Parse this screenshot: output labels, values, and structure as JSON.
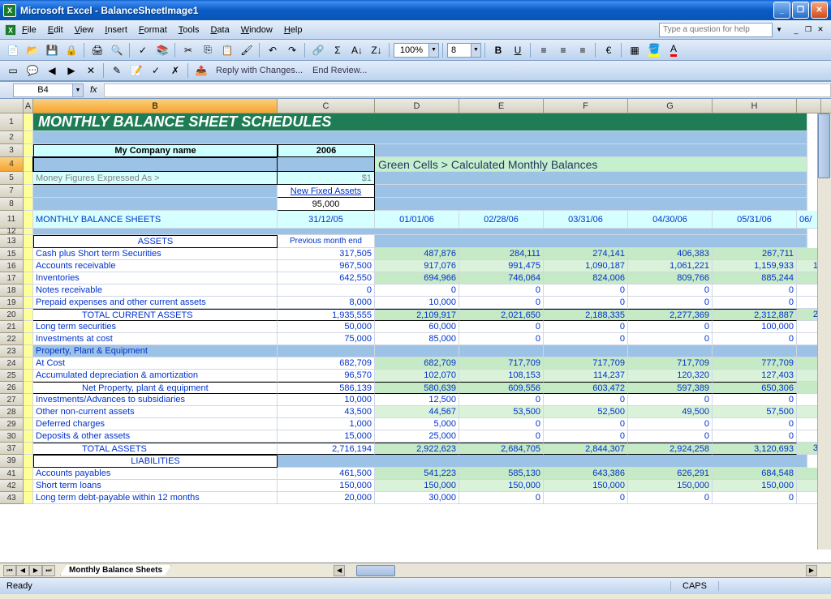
{
  "titlebar": {
    "text": "Microsoft Excel - BalanceSheetImage1"
  },
  "menus": [
    "File",
    "Edit",
    "View",
    "Insert",
    "Format",
    "Tools",
    "Data",
    "Window",
    "Help"
  ],
  "help_placeholder": "Type a question for help",
  "toolbar": {
    "zoom": "100%",
    "font_size": "8",
    "reply": "Reply with Changes...",
    "end": "End Review..."
  },
  "namebox": "B4",
  "sheet": {
    "cols": [
      "A",
      "B",
      "C",
      "D",
      "E",
      "F",
      "G",
      "H"
    ],
    "title": "MONTHLY BALANCE SHEET SCHEDULES",
    "company": "My Company name",
    "year": "2006",
    "legend": "Green Cells > Calculated Monthly Balances",
    "money_label": "Money Figures Expressed As >",
    "money_val": "$1",
    "nfa_label": "New Fixed Assets",
    "nfa_val": "95,000",
    "mbs_label": "MONTHLY BALANCE SHEETS",
    "dates": [
      "31/12/05",
      "01/01/06",
      "02/28/06",
      "03/31/06",
      "04/30/06",
      "05/31/06"
    ],
    "date_next": "06/",
    "prev_month": "Previous month end",
    "assets_h": "ASSETS",
    "liab_h": "LIABILITIES",
    "rows": [
      {
        "n": "15",
        "label": "Cash plus Short term Securities",
        "vals": [
          "317,505",
          "487,876",
          "284,111",
          "274,141",
          "406,383",
          "267,711"
        ],
        "style": "green",
        "tr": ""
      },
      {
        "n": "16",
        "label": "Accounts receivable",
        "vals": [
          "967,500",
          "917,076",
          "991,475",
          "1,090,187",
          "1,061,221",
          "1,159,933"
        ],
        "style": "ltgreen",
        "tr": "1"
      },
      {
        "n": "17",
        "label": "Inventories",
        "vals": [
          "642,550",
          "694,966",
          "746,064",
          "824,006",
          "809,766",
          "885,244"
        ],
        "style": "green",
        "tr": ""
      },
      {
        "n": "18",
        "label": "Notes receivable",
        "vals": [
          "0",
          "0",
          "0",
          "0",
          "0",
          "0"
        ],
        "style": "white",
        "tr": ""
      },
      {
        "n": "19",
        "label": "Prepaid expenses and other current assets",
        "vals": [
          "8,000",
          "10,000",
          "0",
          "0",
          "0",
          "0"
        ],
        "style": "white",
        "tr": ""
      },
      {
        "n": "20",
        "label": "TOTAL CURRENT ASSETS",
        "vals": [
          "1,935,555",
          "2,109,917",
          "2,021,650",
          "2,188,335",
          "2,277,369",
          "2,312,887"
        ],
        "style": "green",
        "tr": "2",
        "indent": true,
        "bt": true
      },
      {
        "n": "21",
        "label": "Long term securities",
        "vals": [
          "50,000",
          "60,000",
          "0",
          "0",
          "0",
          "100,000"
        ],
        "style": "white",
        "tr": ""
      },
      {
        "n": "22",
        "label": "Investments at cost",
        "vals": [
          "75,000",
          "85,000",
          "0",
          "0",
          "0",
          "0"
        ],
        "style": "white",
        "tr": ""
      },
      {
        "n": "23",
        "label": "Property, Plant & Equipment",
        "vals": [
          "",
          "",
          "",
          "",
          "",
          ""
        ],
        "style": "skblue",
        "tr": ""
      },
      {
        "n": "24",
        "label": "At Cost",
        "vals": [
          "682,709",
          "682,709",
          "717,709",
          "717,709",
          "717,709",
          "777,709"
        ],
        "style": "green",
        "tr": ""
      },
      {
        "n": "25",
        "label": "Accumulated depreciation & amortization",
        "vals": [
          "96,570",
          "102,070",
          "108,153",
          "114,237",
          "120,320",
          "127,403"
        ],
        "style": "ltgreen",
        "tr": ""
      },
      {
        "n": "26",
        "label": "Net Property, plant & equipment",
        "vals": [
          "586,139",
          "580,639",
          "609,556",
          "603,472",
          "597,389",
          "650,306"
        ],
        "style": "green",
        "tr": "",
        "indent": true,
        "bt": true
      },
      {
        "n": "27",
        "label": "Investments/Advances to subsidiaries",
        "vals": [
          "10,000",
          "12,500",
          "0",
          "0",
          "0",
          "0"
        ],
        "style": "white",
        "tr": ""
      },
      {
        "n": "28",
        "label": "Other non-current assets",
        "vals": [
          "43,500",
          "44,567",
          "53,500",
          "52,500",
          "49,500",
          "57,500"
        ],
        "style": "ltgreen",
        "tr": ""
      },
      {
        "n": "29",
        "label": "Deferred charges",
        "vals": [
          "1,000",
          "5,000",
          "0",
          "0",
          "0",
          "0"
        ],
        "style": "white",
        "tr": ""
      },
      {
        "n": "30",
        "label": "Deposits & other assets",
        "vals": [
          "15,000",
          "25,000",
          "0",
          "0",
          "0",
          "0"
        ],
        "style": "white",
        "tr": ""
      },
      {
        "n": "37",
        "label": "TOTAL ASSETS",
        "vals": [
          "2,716,194",
          "2,922,623",
          "2,684,705",
          "2,844,307",
          "2,924,258",
          "3,120,693"
        ],
        "style": "green",
        "tr": "3",
        "indent": true,
        "bt": true
      }
    ],
    "liab_rows": [
      {
        "n": "41",
        "label": "Accounts payables",
        "vals": [
          "461,500",
          "541,223",
          "585,130",
          "643,386",
          "626,291",
          "684,548"
        ],
        "style": "green"
      },
      {
        "n": "42",
        "label": "Short term loans",
        "vals": [
          "150,000",
          "150,000",
          "150,000",
          "150,000",
          "150,000",
          "150,000"
        ],
        "style": "ltgreen"
      },
      {
        "n": "43",
        "label": "Long term debt-payable within 12 months",
        "vals": [
          "20,000",
          "30,000",
          "0",
          "0",
          "0",
          "0"
        ],
        "style": "white"
      }
    ]
  },
  "tab_name": "Monthly Balance Sheets",
  "status": {
    "ready": "Ready",
    "caps": "CAPS"
  }
}
